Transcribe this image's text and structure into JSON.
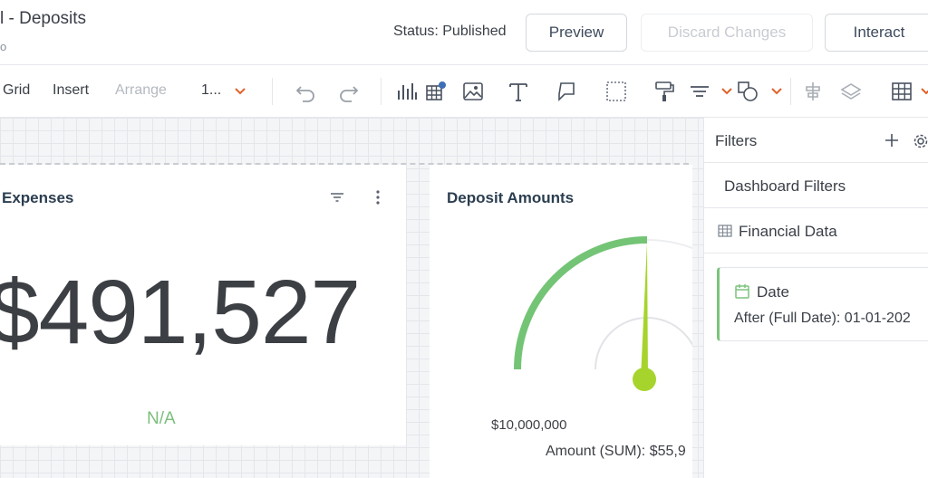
{
  "header": {
    "title": "l - Deposits",
    "subtitle": "o",
    "status": "Status: Published",
    "buttons": {
      "preview": "Preview",
      "discard": "Discard Changes",
      "interact": "Interact"
    }
  },
  "toolbar": {
    "menus": {
      "grid": "Grid",
      "insert": "Insert",
      "arrange": "Arrange",
      "zoom": "1..."
    },
    "icons": [
      "undo-icon",
      "redo-icon",
      "chart-icon",
      "table-icon",
      "image-icon",
      "text-icon",
      "comment-icon",
      "selection-icon",
      "format-painter-icon",
      "align-icon",
      "shapes-icon",
      "align-center-icon",
      "layers-icon",
      "grid-table-icon"
    ],
    "accent_color": "#e0622a"
  },
  "widgets": {
    "expenses": {
      "title": "Expenses",
      "value": "$491,527",
      "comparison": "N/A"
    },
    "deposit": {
      "title": "Deposit Amounts",
      "min_label": "$10,000,000",
      "value_label": "Amount (SUM): $55,9"
    }
  },
  "gauge": {
    "fill_color": "#74c476",
    "needle_color": "#a6d42c",
    "fill_fraction": 0.5
  },
  "filters": {
    "title": "Filters",
    "dashboard_filters": "Dashboard Filters",
    "data_source": "Financial Data",
    "date_filter": {
      "title": "Date",
      "value": "After (Full Date): 01-01-202"
    }
  }
}
